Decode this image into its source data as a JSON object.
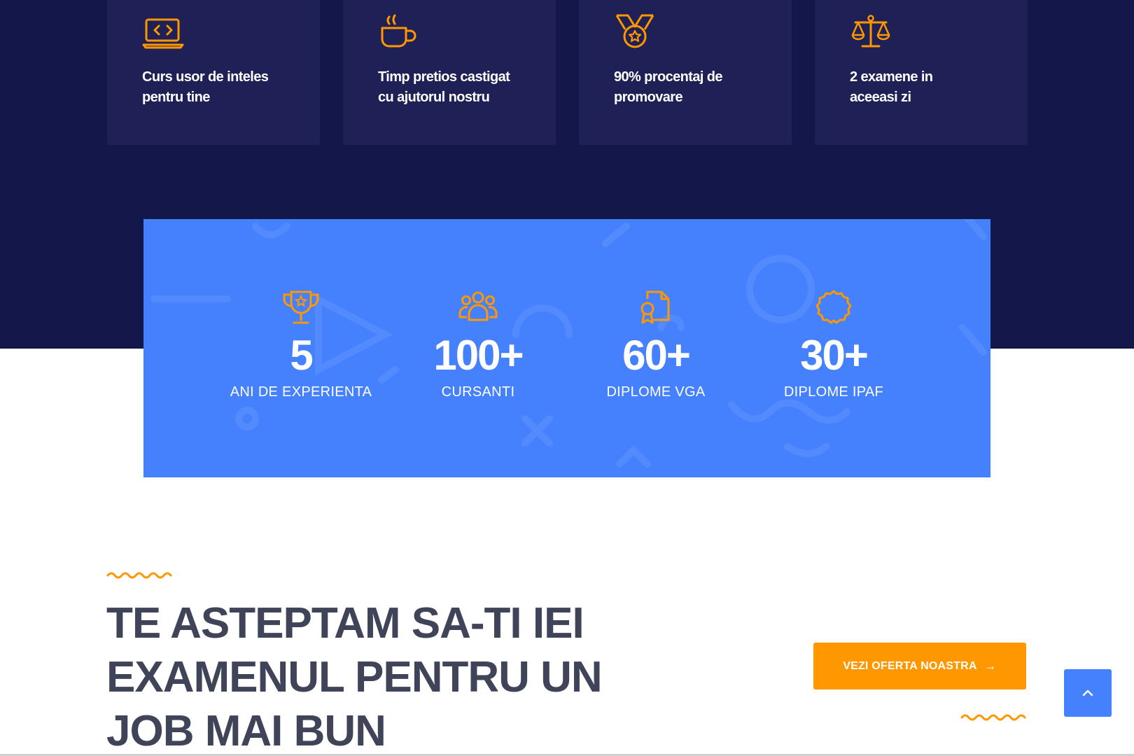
{
  "features": [
    {
      "icon": "laptop-code-icon",
      "text_line1": "Curs usor de inteles",
      "text_line2": "pentru tine"
    },
    {
      "icon": "coffee-cup-icon",
      "text_line1": "Timp pretios castigat",
      "text_line2": "cu ajutorul nostru"
    },
    {
      "icon": "medal-icon",
      "text_line1": "90% procentaj de",
      "text_line2": "promovare"
    },
    {
      "icon": "balance-scale-icon",
      "text_line1": "2 examene in",
      "text_line2": "aceeasi zi"
    }
  ],
  "stats": [
    {
      "icon": "trophy-icon",
      "number": "5",
      "label": "ANI DE EXPERIENTA"
    },
    {
      "icon": "users-group-icon",
      "number": "100+",
      "label": "CURSANTI"
    },
    {
      "icon": "certificate-document-icon",
      "number": "60+",
      "label": "DIPLOME VGA"
    },
    {
      "icon": "badge-seal-icon",
      "number": "30+",
      "label": "DIPLOME IPAF"
    }
  ],
  "cta": {
    "title_line1": "TE ASTEPTAM SA-TI IEI",
    "title_line2": "EXAMENUL PENTRU UN",
    "title_line3": "JOB MAI BUN",
    "button_label": "VEZI OFERTA NOASTRA",
    "button_arrow": "→"
  },
  "back_to_top": {
    "icon": "chevron-up-icon"
  },
  "colors": {
    "dark_navy": "#14174a",
    "card_navy": "#1e2056",
    "stats_blue": "#4581fd",
    "accent_orange": "#ff9800",
    "heading_gray": "#3f4458"
  }
}
